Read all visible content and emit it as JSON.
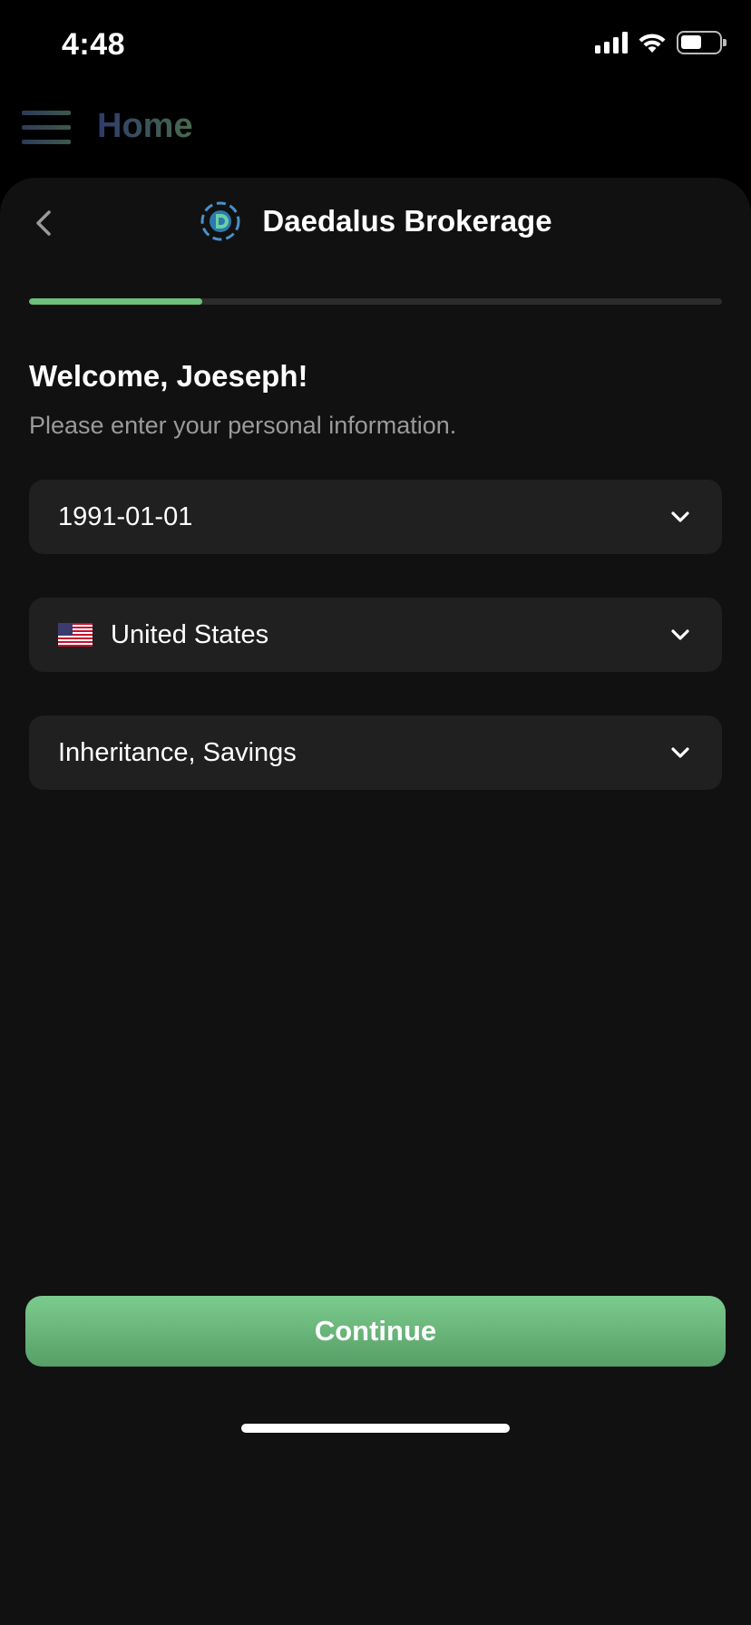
{
  "status_bar": {
    "time": "4:48",
    "battery_level": 0.5
  },
  "top_nav": {
    "title": "Home"
  },
  "header": {
    "brand_name": "Daedalus Brokerage"
  },
  "progress": {
    "fraction": 0.25
  },
  "welcome": {
    "title": "Welcome, Joeseph!",
    "subtitle": "Please enter your personal information."
  },
  "fields": {
    "birthdate": {
      "value": "1991-01-01"
    },
    "country": {
      "value": "United States",
      "flag_icon": "us-flag-icon"
    },
    "funds_source": {
      "value": "Inheritance, Savings"
    }
  },
  "actions": {
    "continue_label": "Continue"
  },
  "colors": {
    "accent": "#6cc07b",
    "sheet_bg": "#111111",
    "field_bg": "#202020"
  }
}
